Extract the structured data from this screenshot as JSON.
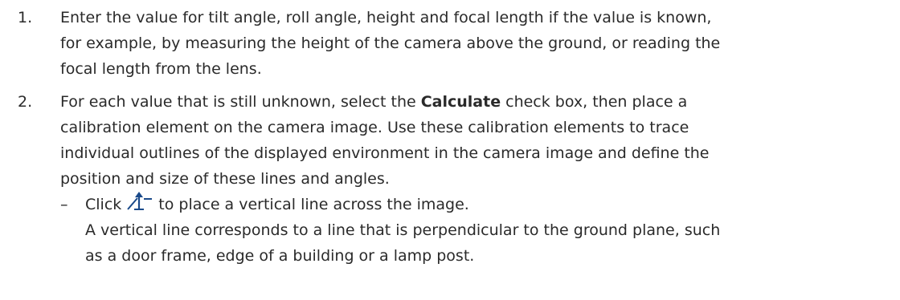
{
  "steps": [
    {
      "number": "1.",
      "lines": [
        "Enter the value for tilt angle, roll angle, height and focal length if the value is known,",
        "for example, by measuring the height of the camera above the ground, or reading the",
        "focal length from the lens."
      ]
    },
    {
      "number": "2.",
      "line1_before": "For each value that is still unknown, select the ",
      "line1_bold": "Calculate",
      "line1_after": " check box, then place a",
      "lines": [
        "calibration element on the camera image. Use these calibration elements to trace",
        "individual outlines of the displayed environment in the camera image and define the",
        "position and size of these lines and angles."
      ]
    }
  ],
  "bullet": {
    "dash": "–",
    "click_text": "Click",
    "icon_name": "vertical-line-icon",
    "after_icon": "to place a vertical line across the image.",
    "lines": [
      "A vertical line corresponds to a line that is perpendicular to the ground plane, such",
      "as a door frame, edge of a building or a lamp post."
    ]
  },
  "colors": {
    "text": "#2a2a2a",
    "icon": "#1a4a8a"
  }
}
